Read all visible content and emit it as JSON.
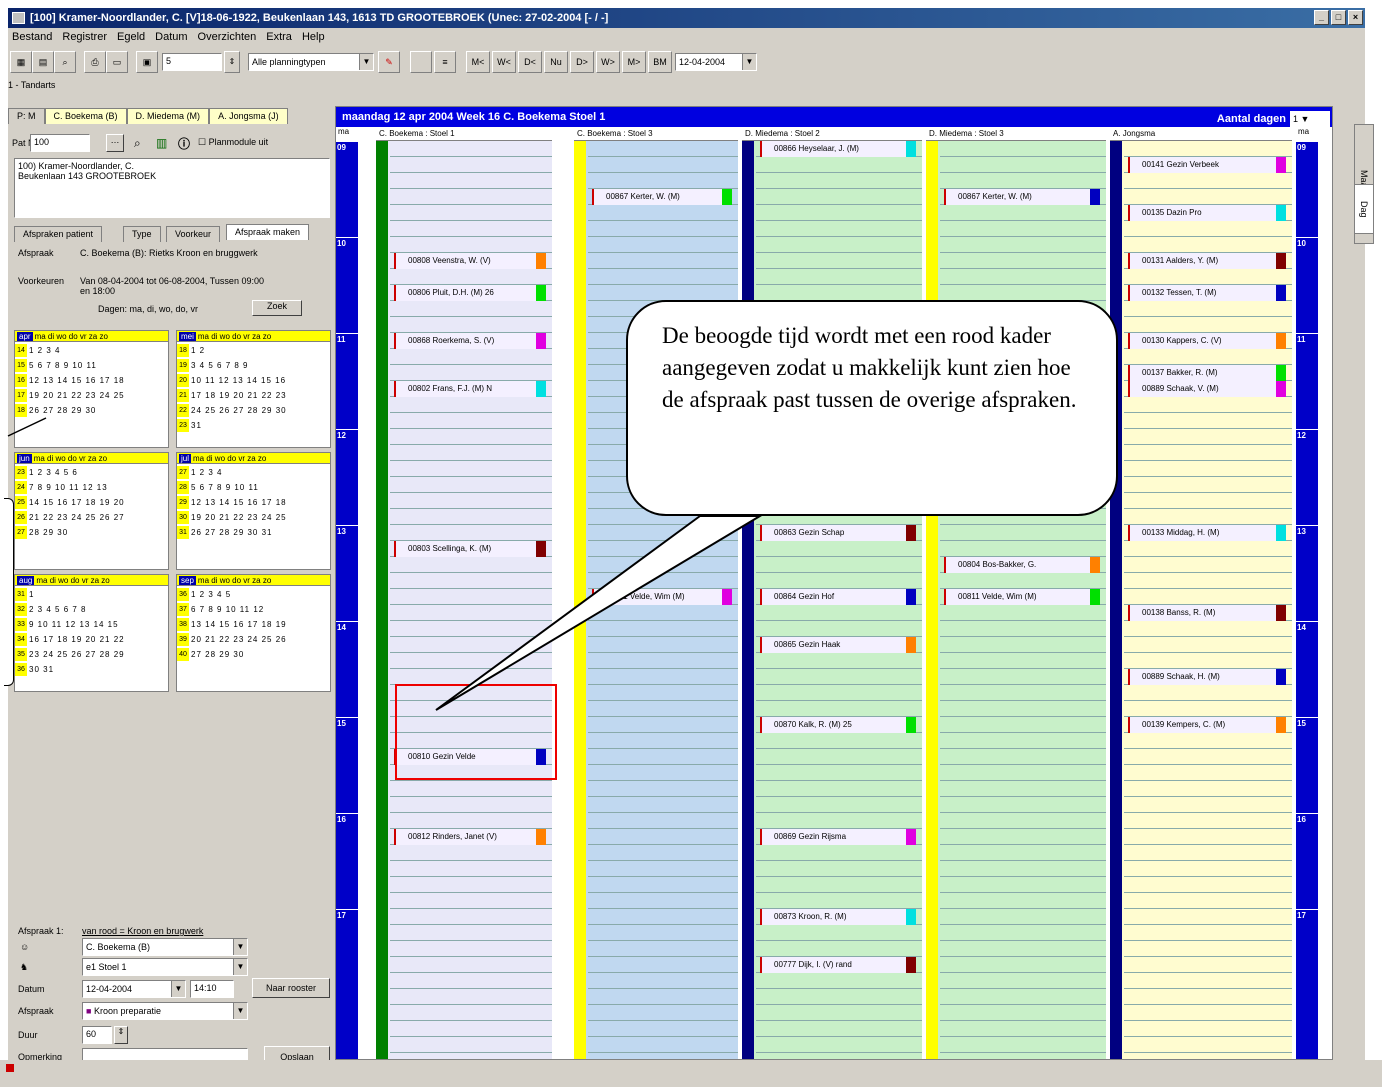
{
  "window": {
    "title": "[100] Kramer-Noordlander, C. [V]18-06-1922, Beukenlaan 143, 1613 TD GROOTEBROEK (Unec: 27-02-2004 [- / -]"
  },
  "menu": [
    "Bestand",
    "Registrer",
    "Egeld",
    "Datum",
    "Overzichten",
    "Extra",
    "Help"
  ],
  "toolbar": {
    "count": "5",
    "planning_filter": "Alle planningtypen",
    "nav_buttons": [
      "M<",
      "W<",
      "D<",
      "Nu",
      "D>",
      "W>",
      "M>",
      "BM"
    ],
    "date": "12-04-2004"
  },
  "subtab": "1 - Tandarts",
  "patient_tabs": [
    "P: M",
    "C. Boekema (B)",
    "D. Miedema (M)",
    "A. Jongsma (J)"
  ],
  "left": {
    "patient_nr_label": "Pat Nr",
    "patient_nr": "100",
    "planmodule": "Planmodule uit",
    "patient_info": [
      "100) Kramer-Noordlander, C.",
      "Beukenlaan 143 GROOTEBROEK"
    ],
    "tabs": [
      "Afspraken patient",
      "Type",
      "Voorkeur",
      "Afspraak maken"
    ],
    "afspraak_label": "Afspraak",
    "afspraak_value": "C. Boekema (B): Rietks Kroon en bruggwerk",
    "voorkeuren_label": "Voorkeuren",
    "voorkeuren_value": "Van 08-04-2004 tot 06-08-2004, Tussen 09:00 en 18:00",
    "dagen": "Dagen: ma, di, wo, do, vr",
    "zoek": "Zoek",
    "afspraak1_label": "Afspraak 1:",
    "afspraak1_value": "van rood = Kroon en brugwerk",
    "behandelaar": "C. Boekema (B)",
    "stoel": "e1 Stoel 1",
    "datum_label": "Datum",
    "datum": "12-04-2004",
    "tijd": "14:10",
    "naar_rooster": "Naar rooster",
    "afspraak_type_label": "Afspraak",
    "afspraak_type": "Kroon preparatie",
    "duur_label": "Duur",
    "duur": "60",
    "opmerking_label": "Opmerking",
    "opslaan": "Opslaan"
  },
  "calendars": [
    {
      "month": "apr",
      "days": "ma di wo do vr za zo",
      "weeks": [
        "14",
        "15",
        "16",
        "17",
        "18"
      ],
      "rows": [
        "1 2 3 4",
        "5 6 7 8 9 10 11",
        "12 13 14 15 16 17 18",
        "19 20 21 22 23 24 25",
        "26 27 28 29 30"
      ]
    },
    {
      "month": "mei",
      "days": "ma di wo do vr za zo",
      "weeks": [
        "18",
        "19",
        "20",
        "21",
        "22",
        "23"
      ],
      "rows": [
        "1 2",
        "3 4 5 6 7 8 9",
        "10 11 12 13 14 15 16",
        "17 18 19 20 21 22 23",
        "24 25 26 27 28 29 30",
        "31"
      ]
    },
    {
      "month": "jun",
      "days": "ma di wo do vr za zo",
      "weeks": [
        "23",
        "24",
        "25",
        "26",
        "27"
      ],
      "rows": [
        "1 2 3 4 5 6",
        "7 8 9 10 11 12 13",
        "14 15 16 17 18 19 20",
        "21 22 23 24 25 26 27",
        "28 29 30"
      ]
    },
    {
      "month": "jul",
      "days": "ma di wo do vr za zo",
      "weeks": [
        "27",
        "28",
        "29",
        "30",
        "31"
      ],
      "rows": [
        "1 2 3 4",
        "5 6 7 8 9 10 11",
        "12 13 14 15 16 17 18",
        "19 20 21 22 23 24 25",
        "26 27 28 29 30 31"
      ]
    },
    {
      "month": "aug",
      "days": "ma di wo do vr za zo",
      "weeks": [
        "31",
        "32",
        "33",
        "34",
        "35",
        "36"
      ],
      "rows": [
        "1",
        "2 3 4 5 6 7 8",
        "9 10 11 12 13 14 15",
        "16 17 18 19 20 21 22",
        "23 24 25 26 27 28 29",
        "30 31"
      ]
    },
    {
      "month": "sep",
      "days": "ma di wo do vr za zo",
      "weeks": [
        "36",
        "37",
        "38",
        "39",
        "40"
      ],
      "rows": [
        "1 2 3 4 5",
        "6 7 8 9 10 11 12",
        "13 14 15 16 17 18 19",
        "20 21 22 23 24 25 26",
        "27 28 29 30"
      ]
    }
  ],
  "planner": {
    "header": "maandag 12 apr 2004    Week 16    C. Boekema    Stoel 1",
    "aantal_dagen": "Aantal dagen",
    "aantal": "1",
    "tijd_label": "ma",
    "columns": [
      "C. Boekema : Stoel 1",
      "C. Boekema : Stoel 3",
      "D. Miedema : Stoel 2",
      "D. Miedema : Stoel 3",
      "A. Jongsma"
    ],
    "hours": [
      "09",
      "10",
      "11",
      "12",
      "13",
      "14",
      "15",
      "16",
      "17"
    ],
    "appointments": [
      {
        "col": 0,
        "text": "00808 Veenstra, W. (V)",
        "slot": 7
      },
      {
        "col": 0,
        "text": "00806 Pluit, D.H. (M) 26",
        "slot": 9
      },
      {
        "col": 0,
        "text": "00868 Roerkema, S. (V)",
        "slot": 12
      },
      {
        "col": 0,
        "text": "00802 Frans, F.J. (M) N",
        "slot": 15
      },
      {
        "col": 0,
        "text": "00803 Scellinga, K. (M)",
        "slot": 25
      },
      {
        "col": 0,
        "text": "00810 Gezin Velde",
        "slot": 38
      },
      {
        "col": 0,
        "text": "00812 Rinders, Janet (V)",
        "slot": 43
      },
      {
        "col": 1,
        "text": "00867 Kerter, W. (M)",
        "slot": 3
      },
      {
        "col": 1,
        "text": "00811 Velde, Wim (M)",
        "slot": 28
      },
      {
        "col": 2,
        "text": "00866 Heyselaar, J. (M)",
        "slot": 0
      },
      {
        "col": 2,
        "text": "00863 Gezin Schap",
        "slot": 24
      },
      {
        "col": 2,
        "text": "00864 Gezin Hof",
        "slot": 28
      },
      {
        "col": 2,
        "text": "00865 Gezin Haak",
        "slot": 31
      },
      {
        "col": 2,
        "text": "00870 Kalk, R. (M) 25",
        "slot": 36
      },
      {
        "col": 2,
        "text": "00869 Gezin Rijsma",
        "slot": 43
      },
      {
        "col": 2,
        "text": "00873 Kroon, R. (M)",
        "slot": 48
      },
      {
        "col": 2,
        "text": "00777 Dijk, I. (V) rand",
        "slot": 51
      },
      {
        "col": 3,
        "text": "00867 Kerter, W. (M)",
        "slot": 3
      },
      {
        "col": 3,
        "text": "00804 Bos-Bakker, G.",
        "slot": 26
      },
      {
        "col": 3,
        "text": "00811 Velde, Wim (M)",
        "slot": 28
      },
      {
        "col": 4,
        "text": "00141 Gezin Verbeek",
        "slot": 1
      },
      {
        "col": 4,
        "text": "00135 Dazin Pro",
        "slot": 4
      },
      {
        "col": 4,
        "text": "00131 Aalders, Y. (M)",
        "slot": 7
      },
      {
        "col": 4,
        "text": "00132 Tessen, T. (M)",
        "slot": 9
      },
      {
        "col": 4,
        "text": "00130 Kappers, C. (V)",
        "slot": 12
      },
      {
        "col": 4,
        "text": "00137 Bakker, R. (M)",
        "slot": 14
      },
      {
        "col": 4,
        "text": "00889 Schaak, V. (M)",
        "slot": 15
      },
      {
        "col": 4,
        "text": "00133 Middag, H. (M)",
        "slot": 24
      },
      {
        "col": 4,
        "text": "00138 Banss, R. (M)",
        "slot": 29
      },
      {
        "col": 4,
        "text": "00889 Schaak, H. (M)",
        "slot": 33
      },
      {
        "col": 4,
        "text": "00139 Kempers, C. (M)",
        "slot": 36
      }
    ]
  },
  "callout": {
    "text": "De beoogde tijd wordt met een rood kader aangegeven zodat u makkelijk kunt zien hoe de afspraak past tussen de overige afspraken."
  },
  "side_tabs": [
    "Maand",
    "Dag"
  ]
}
